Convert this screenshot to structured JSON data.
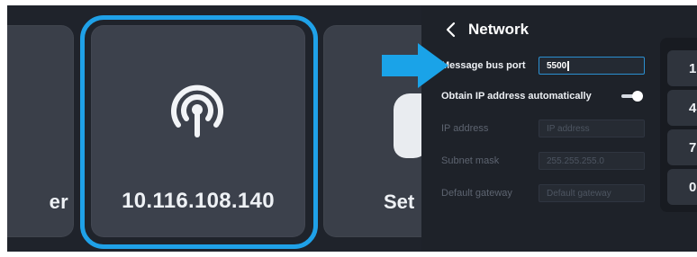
{
  "tiles": {
    "left_label": "er",
    "center_ip": "10.116.108.140",
    "right_label": "Set"
  },
  "icons": {
    "center": "wifi-broadcast-icon",
    "back": "chevron-left-icon",
    "arrow": "arrow-right-icon"
  },
  "network": {
    "title": "Network",
    "message_bus_port": {
      "label": "Message bus port",
      "value": "5500"
    },
    "obtain_ip": {
      "label": "Obtain IP address automatically",
      "enabled": true
    },
    "ip_address": {
      "label": "IP address",
      "placeholder": "IP address"
    },
    "subnet_mask": {
      "label": "Subnet mask",
      "placeholder": "255.255.255.0"
    },
    "default_gateway": {
      "label": "Default gateway",
      "placeholder": "Default gateway"
    }
  },
  "keypad": {
    "keys": [
      "1",
      "4",
      "7",
      "0"
    ]
  },
  "colors": {
    "accent": "#1fa1e8",
    "background": "#1f232b",
    "tile": "#3a3f49"
  }
}
